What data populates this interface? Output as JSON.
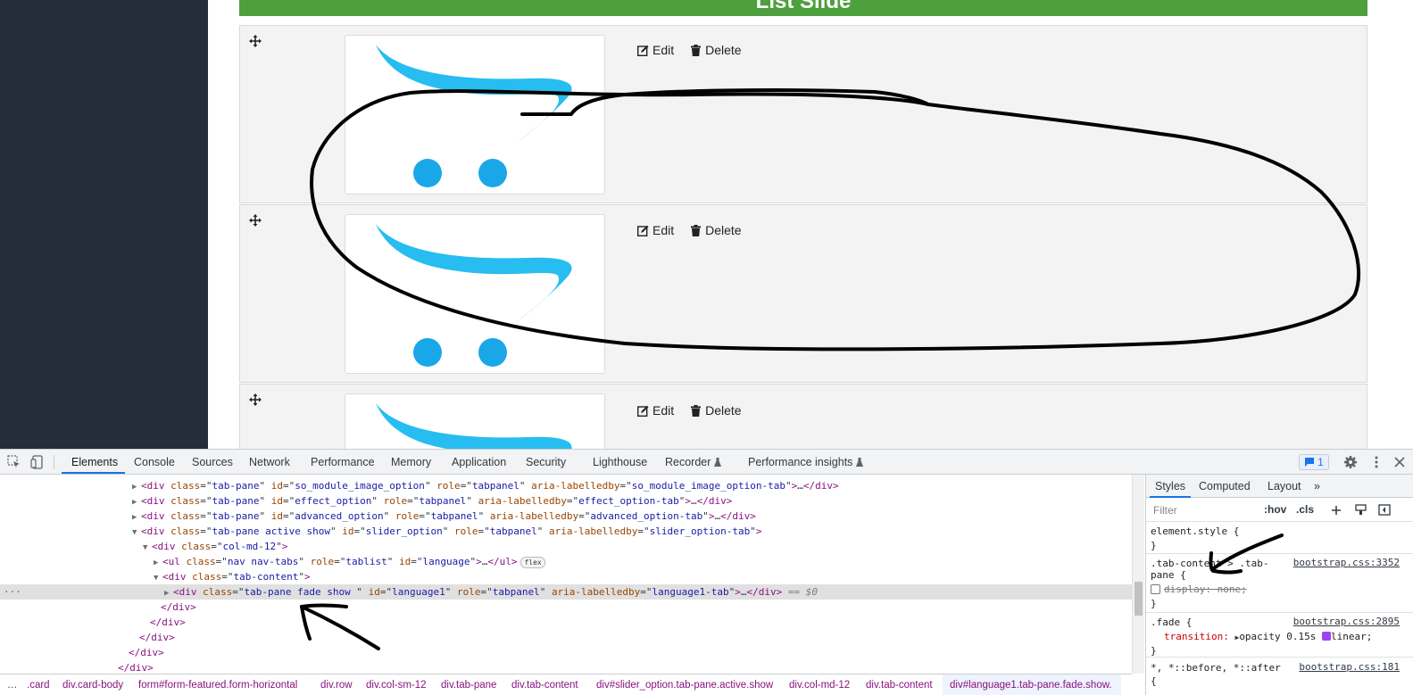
{
  "page": {
    "header_title": "List Slide",
    "slides": [
      {
        "edit_label": "Edit",
        "delete_label": "Delete"
      },
      {
        "edit_label": "Edit",
        "delete_label": "Delete"
      },
      {
        "edit_label": "Edit",
        "delete_label": "Delete"
      }
    ]
  },
  "devtools": {
    "tabs": [
      "Elements",
      "Console",
      "Sources",
      "Network",
      "Performance",
      "Memory",
      "Application",
      "Security",
      "Lighthouse",
      "Recorder",
      "Performance insights"
    ],
    "active_tab": "Elements",
    "issues_count": "1",
    "elements_lines": [
      {
        "tw": "▶",
        "parts": [
          [
            "tag",
            "<div "
          ],
          [
            "an",
            "class"
          ],
          [
            "pl",
            "=\""
          ],
          [
            "av",
            "tab-pane"
          ],
          [
            "pl",
            "\" "
          ],
          [
            "an",
            "id"
          ],
          [
            "pl",
            "=\""
          ],
          [
            "av",
            "so_module_image_option"
          ],
          [
            "pl",
            "\" "
          ],
          [
            "an",
            "role"
          ],
          [
            "pl",
            "=\""
          ],
          [
            "av",
            "tabpanel"
          ],
          [
            "pl",
            "\" "
          ],
          [
            "an",
            "aria-labelledby"
          ],
          [
            "pl",
            "=\""
          ],
          [
            "av",
            "so_module_image_option-tab"
          ],
          [
            "pl",
            "\""
          ],
          [
            "tag",
            ">"
          ],
          [
            "pl",
            "…"
          ],
          [
            "tag",
            "</div>"
          ]
        ]
      },
      {
        "tw": "▶",
        "parts": [
          [
            "tag",
            "<div "
          ],
          [
            "an",
            "class"
          ],
          [
            "pl",
            "=\""
          ],
          [
            "av",
            "tab-pane"
          ],
          [
            "pl",
            "\" "
          ],
          [
            "an",
            "id"
          ],
          [
            "pl",
            "=\""
          ],
          [
            "av",
            "effect_option"
          ],
          [
            "pl",
            "\" "
          ],
          [
            "an",
            "role"
          ],
          [
            "pl",
            "=\""
          ],
          [
            "av",
            "tabpanel"
          ],
          [
            "pl",
            "\" "
          ],
          [
            "an",
            "aria-labelledby"
          ],
          [
            "pl",
            "=\""
          ],
          [
            "av",
            "effect_option-tab"
          ],
          [
            "pl",
            "\""
          ],
          [
            "tag",
            ">"
          ],
          [
            "pl",
            "…"
          ],
          [
            "tag",
            "</div>"
          ]
        ]
      },
      {
        "tw": "▶",
        "parts": [
          [
            "tag",
            "<div "
          ],
          [
            "an",
            "class"
          ],
          [
            "pl",
            "=\""
          ],
          [
            "av",
            "tab-pane"
          ],
          [
            "pl",
            "\" "
          ],
          [
            "an",
            "id"
          ],
          [
            "pl",
            "=\""
          ],
          [
            "av",
            "advanced_option"
          ],
          [
            "pl",
            "\" "
          ],
          [
            "an",
            "role"
          ],
          [
            "pl",
            "=\""
          ],
          [
            "av",
            "tabpanel"
          ],
          [
            "pl",
            "\" "
          ],
          [
            "an",
            "aria-labelledby"
          ],
          [
            "pl",
            "=\""
          ],
          [
            "av",
            "advanced_option-tab"
          ],
          [
            "pl",
            "\""
          ],
          [
            "tag",
            ">"
          ],
          [
            "pl",
            "…"
          ],
          [
            "tag",
            "</div>"
          ]
        ]
      },
      {
        "tw": "▼",
        "parts": [
          [
            "tag",
            "<div "
          ],
          [
            "an",
            "class"
          ],
          [
            "pl",
            "=\""
          ],
          [
            "av",
            "tab-pane active show"
          ],
          [
            "pl",
            "\" "
          ],
          [
            "an",
            "id"
          ],
          [
            "pl",
            "=\""
          ],
          [
            "av",
            "slider_option"
          ],
          [
            "pl",
            "\" "
          ],
          [
            "an",
            "role"
          ],
          [
            "pl",
            "=\""
          ],
          [
            "av",
            "tabpanel"
          ],
          [
            "pl",
            "\" "
          ],
          [
            "an",
            "aria-labelledby"
          ],
          [
            "pl",
            "=\""
          ],
          [
            "av",
            "slider_option-tab"
          ],
          [
            "pl",
            "\""
          ],
          [
            "tag",
            ">"
          ]
        ]
      },
      {
        "tw": "▼",
        "parts": [
          [
            "tag",
            "<div "
          ],
          [
            "an",
            "class"
          ],
          [
            "pl",
            "=\""
          ],
          [
            "av",
            "col-md-12"
          ],
          [
            "pl",
            "\""
          ],
          [
            "tag",
            ">"
          ]
        ]
      },
      {
        "tw": "▶",
        "parts": [
          [
            "tag",
            "<ul "
          ],
          [
            "an",
            "class"
          ],
          [
            "pl",
            "=\""
          ],
          [
            "av",
            "nav nav-tabs"
          ],
          [
            "pl",
            "\" "
          ],
          [
            "an",
            "role"
          ],
          [
            "pl",
            "=\""
          ],
          [
            "av",
            "tablist"
          ],
          [
            "pl",
            "\" "
          ],
          [
            "an",
            "id"
          ],
          [
            "pl",
            "=\""
          ],
          [
            "av",
            "language"
          ],
          [
            "pl",
            "\""
          ],
          [
            "tag",
            ">"
          ],
          [
            "pl",
            "…"
          ],
          [
            "tag",
            "</ul>"
          ]
        ],
        "badge": "flex"
      },
      {
        "tw": "▼",
        "parts": [
          [
            "tag",
            "<div "
          ],
          [
            "an",
            "class"
          ],
          [
            "pl",
            "=\""
          ],
          [
            "av",
            "tab-content"
          ],
          [
            "pl",
            "\""
          ],
          [
            "tag",
            ">"
          ]
        ]
      },
      {
        "tw": "▶",
        "parts": [
          [
            "tag",
            "<div "
          ],
          [
            "an",
            "class"
          ],
          [
            "pl",
            "=\""
          ],
          [
            "av",
            "tab-pane fade show "
          ],
          [
            "pl",
            "\" "
          ],
          [
            "an",
            "id"
          ],
          [
            "pl",
            "=\""
          ],
          [
            "av",
            "language1"
          ],
          [
            "pl",
            "\" "
          ],
          [
            "an",
            "role"
          ],
          [
            "pl",
            "=\""
          ],
          [
            "av",
            "tabpanel"
          ],
          [
            "pl",
            "\" "
          ],
          [
            "an",
            "aria-labelledby"
          ],
          [
            "pl",
            "=\""
          ],
          [
            "av",
            "language1-tab"
          ],
          [
            "pl",
            "\""
          ],
          [
            "tag",
            ">"
          ],
          [
            "pl",
            "…"
          ],
          [
            "tag",
            "</div>"
          ],
          [
            "pl",
            " == $0"
          ]
        ]
      },
      {
        "tw": "",
        "parts": [
          [
            "tag",
            "</div>"
          ]
        ]
      },
      {
        "tw": "",
        "parts": [
          [
            "tag",
            "</div>"
          ]
        ]
      },
      {
        "tw": "",
        "parts": [
          [
            "tag",
            "</div>"
          ]
        ]
      },
      {
        "tw": "",
        "parts": [
          [
            "tag",
            "</div>"
          ]
        ]
      },
      {
        "tw": "",
        "parts": [
          [
            "tag",
            "</div>"
          ]
        ]
      }
    ],
    "styles": {
      "tabs": [
        "Styles",
        "Computed",
        "Layout",
        "»"
      ],
      "filter_placeholder": "Filter",
      "hov": ":hov",
      "cls": ".cls",
      "element_style": "element.style {",
      "close_brace": "}",
      "rule1_selector_a": ".tab-content > .tab-",
      "rule1_selector_b": "pane {",
      "rule1_source": "bootstrap.css:3352",
      "rule1_prop": "display: none;",
      "rule2_selector": ".fade {",
      "rule2_source": "bootstrap.css:2895",
      "rule2_prop_name": "transition:",
      "rule2_prop_value": "opacity 0.15s",
      "rule2_prop_tail": "linear;",
      "rule3_selector": "*, *::before, *::after",
      "rule3_source": "bootstrap.css:181",
      "rule3_partial": "{"
    },
    "breadcrumb": [
      ".card",
      "div.card-body",
      "form#form-featured.form-horizontal",
      "div.row",
      "div.col-sm-12",
      "div.tab-pane",
      "div.tab-content",
      "div#slider_option.tab-pane.active.show",
      "div.col-md-12",
      "div.tab-content",
      "div#language1.tab-pane.fade.show."
    ],
    "breadcrumb_leading": "…"
  }
}
